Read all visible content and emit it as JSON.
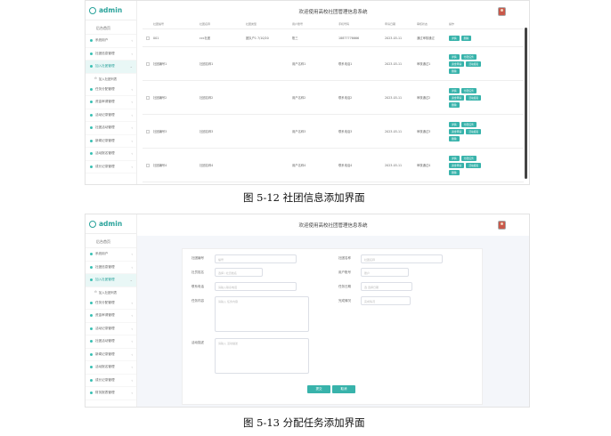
{
  "caption1": "图 5-12 社团信息添加界面",
  "caption2": "图 5-13 分配任务添加界面",
  "app": {
    "brand": "admin",
    "title": "欢迎使用高校社团管理信息系统",
    "home": "后台首页",
    "sub_item": "加入社团列表"
  },
  "nav": [
    "系统用户",
    "社团信息管理",
    "加入社团管理",
    "任务分配管理",
    "资金审请管理",
    "活动记录管理",
    "社团活动管理",
    "新闻记录管理",
    "活动报名管理",
    "成长记录管理"
  ],
  "nav2_extra": "财务报表管理",
  "table": {
    "headers": [
      "社团编号",
      "社团名称",
      "社团类型",
      "用户账号",
      "手机号码",
      "申请日期",
      "审核状态",
      "操作"
    ],
    "rows": [
      {
        "no": "001",
        "name": "ccc社团",
        "type": "团队户1 7/10/20",
        "user": "账三",
        "phone": "18877776666",
        "date": "2023-03-11",
        "status": "通过审核通过"
      },
      {
        "no": "社团编号1",
        "name": "社团名称1",
        "type": "",
        "user": "用户名称1",
        "phone": "联系电话1",
        "date": "2023-03-11",
        "status": "审核通过1"
      },
      {
        "no": "社团编号2",
        "name": "社团名称2",
        "type": "",
        "user": "用户名称2",
        "phone": "联系电话2",
        "date": "2023-03-11",
        "status": "审核通过2"
      },
      {
        "no": "社团编号3",
        "name": "社团名称3",
        "type": "",
        "user": "用户名称3",
        "phone": "联系电话3",
        "date": "2023-03-11",
        "status": "审核通过3"
      },
      {
        "no": "社团编号4",
        "name": "社团名称4",
        "type": "",
        "user": "用户名称4",
        "phone": "联系电话4",
        "date": "2023-03-11",
        "status": "审核通过4"
      }
    ],
    "ops": [
      "详情",
      "分配任务",
      "资金申请",
      "活动报名",
      "删除"
    ]
  },
  "form": {
    "f1": {
      "label": "社团编号",
      "ph": "编号"
    },
    "f2": {
      "label": "社团名称",
      "ph": "社团名称"
    },
    "f3": {
      "label": "社员姓名",
      "ph": "选择 / 社员姓名"
    },
    "f4": {
      "label": "用户账号",
      "ph": "账户"
    },
    "f5": {
      "label": "联系电话",
      "ph": "请输入联系电话"
    },
    "f6": {
      "label": "任务日期",
      "ph": "选 选择日期"
    },
    "f7": {
      "label": "任务内容",
      "ph": "请输入 任务内容"
    },
    "f8": {
      "label": "完成情况",
      "ph": "完成情况"
    },
    "f9": {
      "label": "活动描述",
      "ph": "请输入 活动描述"
    },
    "submit": "提交",
    "cancel": "取消"
  }
}
